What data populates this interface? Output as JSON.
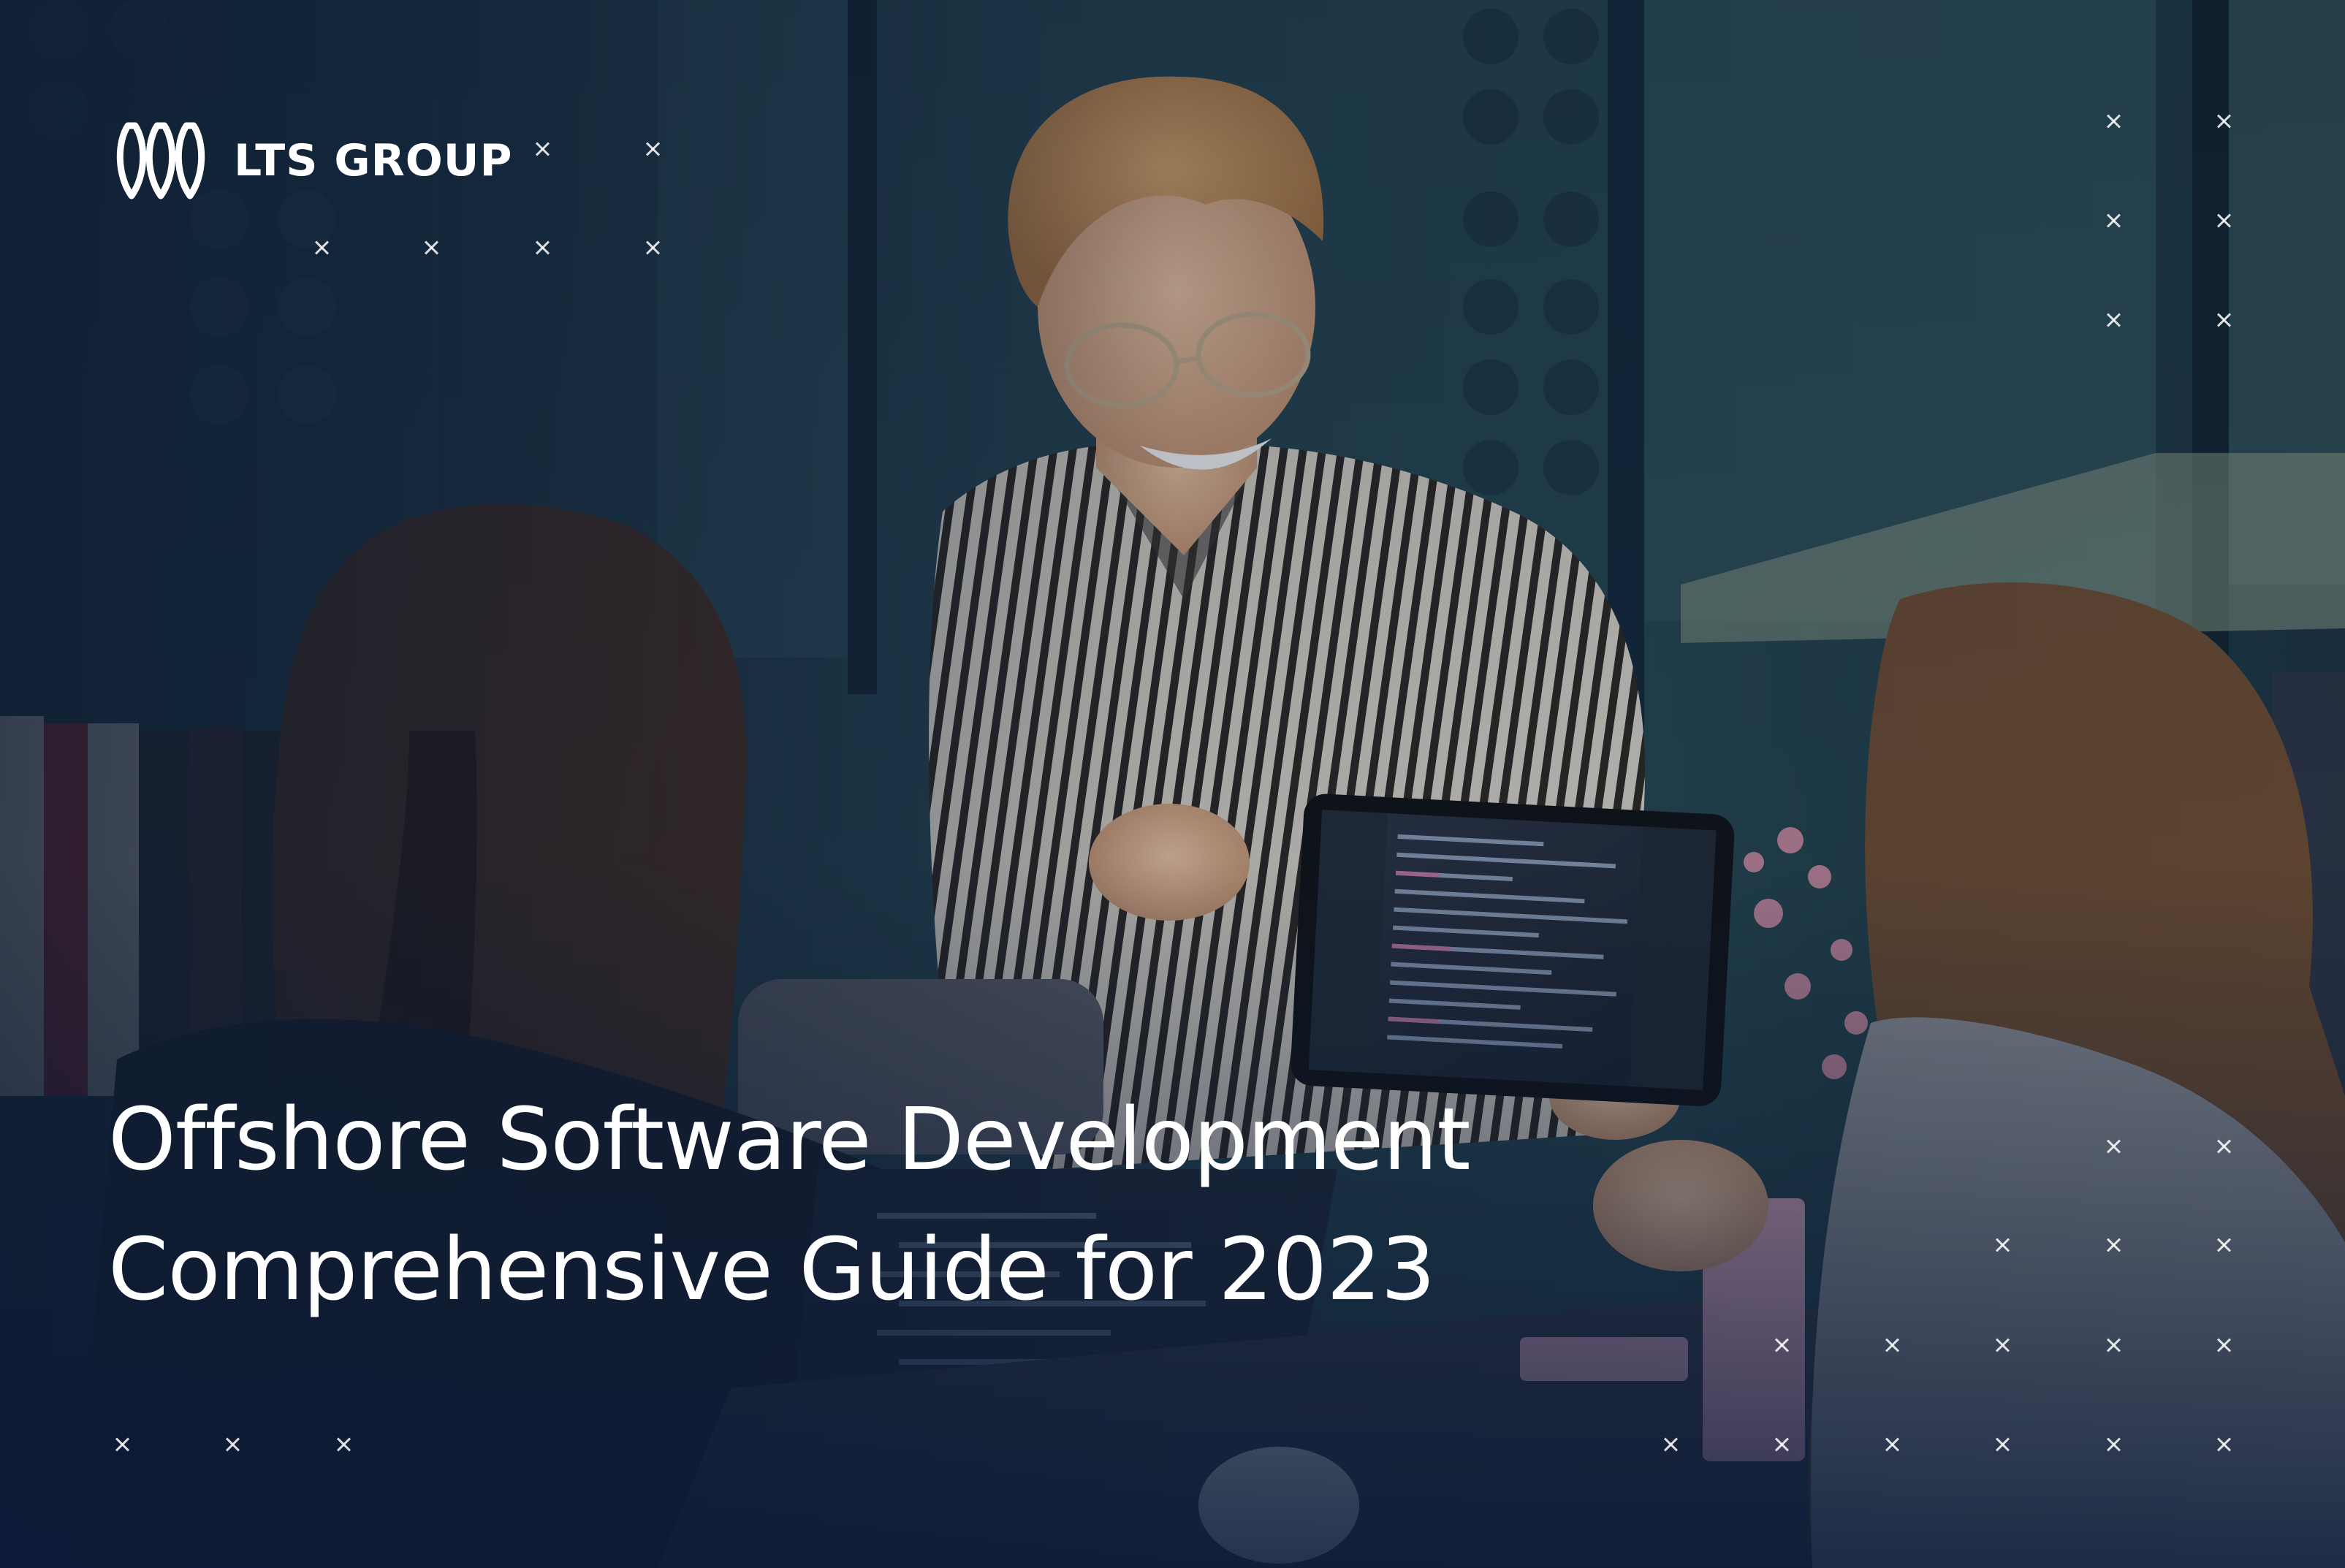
{
  "brand": {
    "name": "LTS GROUP",
    "logo_icon": "lts-logo-icon"
  },
  "headline": {
    "line1": "Offshore Software Development",
    "line2": "Comprehensive Guide for 2023"
  },
  "colors": {
    "text": "#ffffff",
    "overlay": "#0f2240"
  }
}
